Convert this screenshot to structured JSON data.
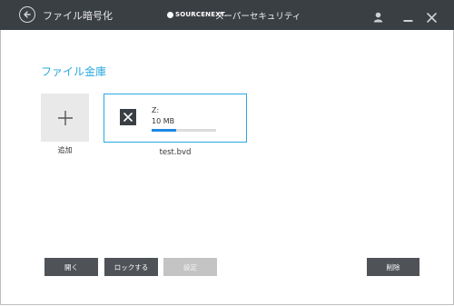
{
  "titlebar": {
    "app_title": "ファイル暗号化",
    "brand_logo": "SOURCENEXT.",
    "product_name": "スーパーセキュリティ",
    "icons": {
      "back": "back-arrow-icon",
      "user": "user-icon",
      "minimize": "minimize-icon",
      "close": "close-icon"
    }
  },
  "main": {
    "section_title": "ファイル金庫",
    "add_label": "追加",
    "vault": {
      "drive_letter": "Z:",
      "size": "10 MB",
      "usage_fraction": 0.38,
      "name": "test.bvd"
    }
  },
  "actions": {
    "open": "開く",
    "lock": "ロックする",
    "settings": "設定",
    "delete": "削除"
  },
  "colors": {
    "titlebar_bg": "#3a3f44",
    "accent": "#29a8e0",
    "progress": "#1e88e5",
    "button_dark": "#4f5358",
    "button_disabled": "#c4c4c4"
  }
}
